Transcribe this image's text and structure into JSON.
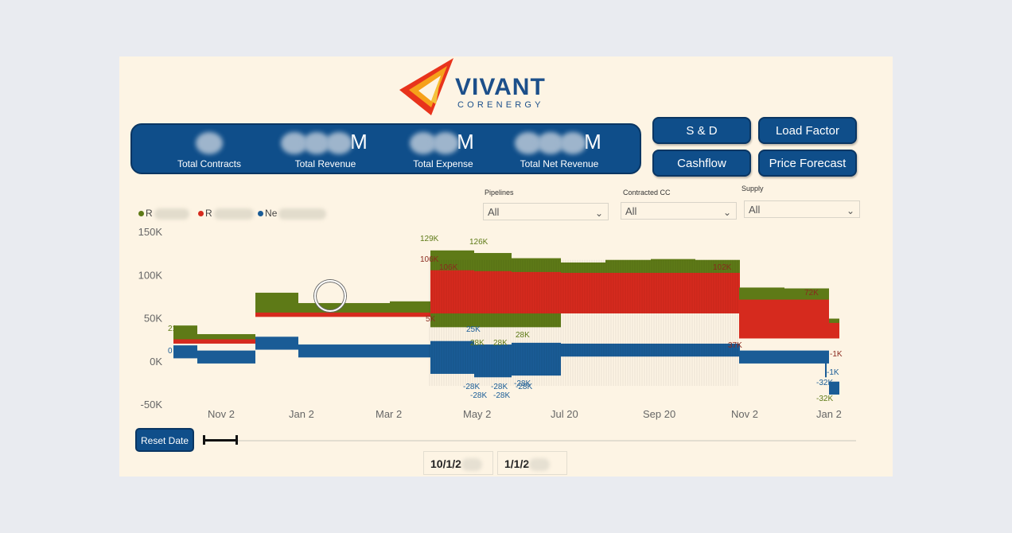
{
  "logo": {
    "name": "VIVANT",
    "subtitle": "CORENERGY"
  },
  "kpis": [
    {
      "value": "M",
      "label": "Total Contracts"
    },
    {
      "value": "M",
      "label": "Total Revenue"
    },
    {
      "value": "M",
      "label": "Total Expense"
    },
    {
      "value": "M",
      "label": "Total Net Revenue"
    }
  ],
  "nav_buttons": {
    "sd": "S & D",
    "load_factor": "Load Factor",
    "cashflow": "Cashflow",
    "price_forecast": "Price Forecast"
  },
  "slicers": {
    "pipelines": {
      "title": "Pipelines",
      "value": "All"
    },
    "contracted_cc": {
      "title": "Contracted CC",
      "value": "All"
    },
    "supply": {
      "title": "Supply",
      "value": "All"
    }
  },
  "legend": [
    {
      "label": "R",
      "color": "#5e7a17"
    },
    {
      "label": "R",
      "color": "#d62a1e"
    },
    {
      "label": "Ne",
      "color": "#1a5c96"
    }
  ],
  "chart_data": {
    "type": "area",
    "y_ticks": [
      "150K",
      "100K",
      "50K",
      "0K",
      "-50K"
    ],
    "ylim": [
      -50000,
      150000
    ],
    "x_ticks": [
      "Nov 2",
      "Jan 2",
      "Mar 2",
      "May 2",
      "Jul 20",
      "Sep 20",
      "Nov 2",
      "Jan 2"
    ],
    "series": [
      {
        "color": "#5e7a17",
        "values": [
          42000,
          32000,
          80000,
          68000,
          70000,
          70000,
          129000,
          126000,
          120000,
          115000,
          118000,
          119000,
          118000,
          120000,
          86000,
          85000,
          50000
        ]
      },
      {
        "color": "#d62a1e",
        "values": [
          26000,
          26000,
          57000,
          57000,
          57000,
          57000,
          106000,
          105000,
          104000,
          103000,
          103000,
          103000,
          103000,
          102000,
          72000,
          72000,
          45000
        ]
      },
      {
        "color": "#1a5c96",
        "values": [
          10000,
          4000,
          20000,
          11000,
          11000,
          11000,
          10000,
          6000,
          8000,
          12000,
          12000,
          12000,
          12000,
          12000,
          4000,
          4000,
          -32000
        ]
      }
    ],
    "data_labels": [
      {
        "text": "21",
        "color": "#5e7a17"
      },
      {
        "text": "0",
        "color": "#1a5c96"
      },
      {
        "text": "129K",
        "color": "#5e7a17"
      },
      {
        "text": "126K",
        "color": "#5e7a17"
      },
      {
        "text": "106K",
        "color": "#8a2a1e"
      },
      {
        "text": "106K",
        "color": "#8a2a1e"
      },
      {
        "text": "5K",
        "color": "#8a2a1e"
      },
      {
        "text": "25K",
        "color": "#1a5c96"
      },
      {
        "text": "28K",
        "color": "#5e7a17"
      },
      {
        "text": "28K",
        "color": "#5e7a17"
      },
      {
        "text": "28K",
        "color": "#5e7a17"
      },
      {
        "text": "-28K",
        "color": "#1a5c96"
      },
      {
        "text": "-28K",
        "color": "#1a5c96"
      },
      {
        "text": "-28K",
        "color": "#1a5c96"
      },
      {
        "text": "-28K",
        "color": "#1a5c96"
      },
      {
        "text": "-28K",
        "color": "#1a5c96"
      },
      {
        "text": "-28K",
        "color": "#1a5c96"
      },
      {
        "text": "102K",
        "color": "#8a2a1e"
      },
      {
        "text": "72K",
        "color": "#8a2a1e"
      },
      {
        "text": "37K",
        "color": "#8a2a1e"
      },
      {
        "text": "-1K",
        "color": "#1a5c96"
      },
      {
        "text": "-32K",
        "color": "#1a5c96"
      },
      {
        "text": "-32K",
        "color": "#5e7a17"
      },
      {
        "text": "-1K",
        "color": "#8a2a1e"
      }
    ]
  },
  "date_range": {
    "reset_label": "Reset Date",
    "start": "10/1/2",
    "end": "1/1/2"
  }
}
